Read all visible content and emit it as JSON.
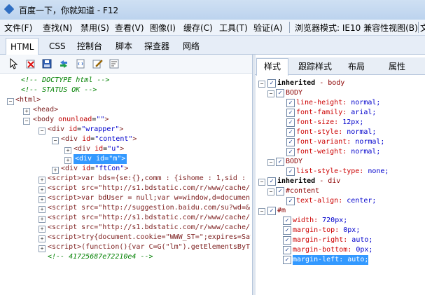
{
  "window": {
    "title": "百度一下，你就知道 - F12"
  },
  "menu": {
    "items": [
      "文件(F)",
      "查找(N)",
      "禁用(S)",
      "查看(V)",
      "图像(I)",
      "缓存(C)",
      "工具(T)",
      "验证(A)"
    ],
    "mode": "浏览器模式: IE10 兼容性视图(B)",
    "overflow": "文"
  },
  "tabs": [
    "HTML",
    "CSS",
    "控制台",
    "脚本",
    "探查器",
    "网络"
  ],
  "toolbar": {
    "icons": [
      "select-element-icon",
      "clear-icon",
      "save-icon",
      "refresh-icon",
      "dom-icon",
      "edit-icon",
      "word-wrap-icon"
    ]
  },
  "tree": {
    "c1": "<!-- DOCTYPE html -->",
    "c2": "<!-- STATUS OK -->",
    "html": "<html>",
    "head": "<head>",
    "body_tag": "<body",
    "body_attr": "onunload",
    "body_val": "\"\"",
    "body_close": ">",
    "wrapper_tag": "<div",
    "wrapper_attr": "id",
    "wrapper_val": "\"wrapper\"",
    "content_val": "\"content\"",
    "u_val": "\"u\"",
    "m_val": "\"m\"",
    "ftcon_val": "\"ftCon\"",
    "gt": ">",
    "s1": "<script>var bds={se:{},comm : {ishome : 1,sid :",
    "s2": "<script src=\"http://s1.bdstatic.com/r/www/cache/",
    "s3": "<script>var bdUser = null;var w=window,d=documen",
    "s4": "<script src=\"http://suggestion.baidu.com/su?wd=&",
    "s5": "<script src=\"http://s1.bdstatic.com/r/www/cache/",
    "s6": "<script src=\"http://s1.bdstatic.com/r/www/cache/",
    "s7": "<script>try{document.cookie=\"WWW_ST=\";expires=Sat",
    "s8": "<script>(function(){var C=G(\"lm\").getElementsByT",
    "c3": "<!-- 41725687e72210e4 -->"
  },
  "right_tabs": [
    "样式",
    "跟踪样式",
    "布局",
    "属性"
  ],
  "styles": {
    "inherited_body": "inherited",
    "dash_body": " - body",
    "body1": "BODY",
    "lh_p": "line-height:",
    "lh_v": " normal;",
    "ff_p": "font-family:",
    "ff_v": " arial;",
    "fs_p": "font-size:",
    "fs_v": " 12px;",
    "fst_p": "font-style:",
    "fst_v": " normal;",
    "fv_p": "font-variant:",
    "fv_v": " normal;",
    "fw_p": "font-weight:",
    "fw_v": " normal;",
    "body2": "BODY",
    "lst_p": "list-style-type:",
    "lst_v": " none;",
    "inherited_div": "inherited",
    "dash_div": " - div",
    "content_sel": "#content",
    "ta_p": "text-align:",
    "ta_v": " center;",
    "m_sel": "#m",
    "w_p": "width:",
    "w_v": " 720px;",
    "mt_p": "margin-top:",
    "mt_v": " 0px;",
    "mr_p": "margin-right:",
    "mr_v": " auto;",
    "mb_p": "margin-bottom:",
    "mb_v": " 0px;",
    "ml_p": "margin-left:",
    "ml_v": " auto;"
  }
}
